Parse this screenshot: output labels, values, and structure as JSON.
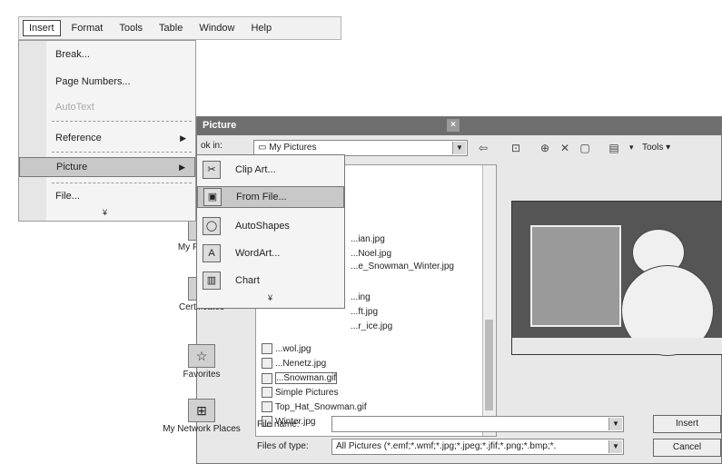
{
  "menubar": {
    "items": [
      "Insert",
      "Format",
      "Tools",
      "Table",
      "Window",
      "Help"
    ]
  },
  "insert_menu": {
    "items": [
      {
        "label": "Break...",
        "has_submenu": false
      },
      {
        "label": "Page Numbers...",
        "has_submenu": false
      },
      {
        "label": "AutoText",
        "has_submenu": false,
        "disabled": true
      },
      {
        "label": "Reference",
        "has_submenu": true
      },
      {
        "label": "Picture",
        "has_submenu": true,
        "highlighted": true
      },
      {
        "label": "File...",
        "has_submenu": false
      }
    ],
    "more_icon": "chevron-double-down-icon"
  },
  "picture_submenu": {
    "items": [
      {
        "label": "Clip Art...",
        "icon": "clip-art-icon"
      },
      {
        "label": "From File...",
        "icon": "from-file-icon",
        "highlighted": true
      },
      {
        "label": "AutoShapes",
        "icon": "autoshapes-icon"
      },
      {
        "label": "WordArt...",
        "icon": "wordart-icon"
      },
      {
        "label": "Chart",
        "icon": "chart-icon"
      }
    ],
    "more_icon": "chevron-double-down-icon"
  },
  "dialog": {
    "title": "Picture",
    "look_in_label": "ok in:",
    "look_in_value": "My Pictures",
    "views_label": "Tools",
    "places": [
      {
        "label": "My Pictures",
        "icon": "folder-icon"
      },
      {
        "label": "Certificates",
        "icon": "certificate-icon"
      },
      {
        "label": "Favorites",
        "icon": "favorites-icon"
      },
      {
        "label": "My Network Places",
        "icon": "network-icon"
      }
    ],
    "files": [
      "...ian.jpg",
      "...Noel.jpg",
      "...e_Snowman_Winter.jpg",
      "...ing",
      "...ft.jpg",
      "...r_ice.jpg",
      "...wol.jpg",
      "...Nenetz.jpg",
      "...Snowman.gif",
      "Simple Pictures",
      "Top_Hat_Snowman.gif",
      "Winter.jpg"
    ],
    "file_name_label": "File name:",
    "file_name_value": "",
    "files_of_type_label": "Files of type:",
    "files_of_type_value": "All Pictures (*.emf;*.wmf;*.jpg;*.jpeg;*.jfif;*.png;*.bmp;*.",
    "insert_button": "Insert",
    "cancel_button": "Cancel"
  }
}
